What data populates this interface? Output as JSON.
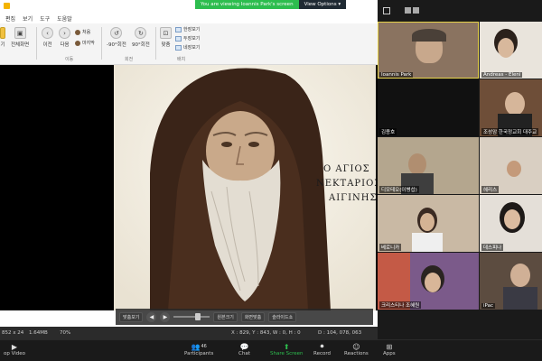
{
  "zoom": {
    "banner_message": "You are viewing Ioannis Park's screen",
    "view_options": "View Options ▾",
    "toolbar": {
      "video_label": "op Video",
      "participants_label": "Participants",
      "participants_count": "46",
      "chat_label": "Chat",
      "share_label": "Share Screen",
      "record_label": "Record",
      "reactions_label": "Reactions",
      "apps_label": "Apps"
    },
    "participants": [
      {
        "name": "Ioannis Park"
      },
      {
        "name": "Andreas - Eleni"
      },
      {
        "name": ""
      },
      {
        "name": "김용호"
      },
      {
        "name": "조성암 한국정교회 대주교"
      },
      {
        "name": ""
      },
      {
        "name": "디모테오(이병섭)"
      },
      {
        "name": "헤리스"
      },
      {
        "name": ""
      },
      {
        "name": "베로니카"
      },
      {
        "name": "데스피나"
      },
      {
        "name": ""
      },
      {
        "name": "크리스티나 조혜원"
      },
      {
        "name": "iPac"
      }
    ]
  },
  "viewer": {
    "menu": [
      "편집",
      "보기",
      "도구",
      "도움말"
    ],
    "ribbon": {
      "btn_fullview": "전체화면",
      "btn_prev": "이전",
      "btn_next": "다음",
      "btn_first": "처음",
      "btn_last": "마지막",
      "btn_rotate_left": "-90°회전",
      "btn_rotate_right": "90°회전",
      "btn_fit": "맞춤",
      "btn_single": "한장보기",
      "btn_double": "두장보기",
      "btn_quad": "네장보기",
      "group_move": "이동",
      "group_rotate": "회전",
      "group_view": "배치",
      "btn_left_partial": "기"
    },
    "image_toolbar": {
      "fit_label": "맞춤보기",
      "original_label": "원본크기",
      "fullscreen_label": "화면맞춤",
      "slideshow_label": "슬라이드쇼",
      "prev_icon": "◀",
      "next_icon": "▶"
    },
    "status": {
      "dimensions": "852 x 24",
      "filesize": "1.64MB",
      "zoom": "70%",
      "coords": "X : 829, Y : 843, W : 0, H : 0",
      "color": "D : 104, 078, 063"
    },
    "image_caption": "Ο ΑΓΙΟΣ ΝΕΚΤΑΡΙΟΣ ΑΙΓΙΝΗΣ"
  }
}
